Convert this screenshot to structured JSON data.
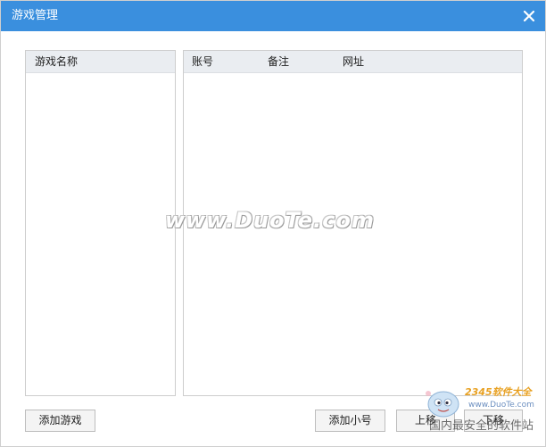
{
  "window": {
    "title": "游戏管理",
    "close_icon": "close-icon"
  },
  "colors": {
    "titlebar": "#3a8fde",
    "header_bg": "#eaedf1",
    "button_bg": "#f4f4f4"
  },
  "games_panel": {
    "header": "游戏名称",
    "items": []
  },
  "accounts_panel": {
    "columns": [
      "账号",
      "备注",
      "网址"
    ],
    "rows": []
  },
  "buttons": {
    "add_game": "添加游戏",
    "add_account": "添加小号",
    "move_up": "上移",
    "move_down": "下移"
  },
  "watermark": {
    "text": "www.DuoTe.com"
  },
  "corner_logo": {
    "brand": "2345软件大全",
    "url": "www.DuoTe.com",
    "tagline": "国内最安全的软件站"
  }
}
